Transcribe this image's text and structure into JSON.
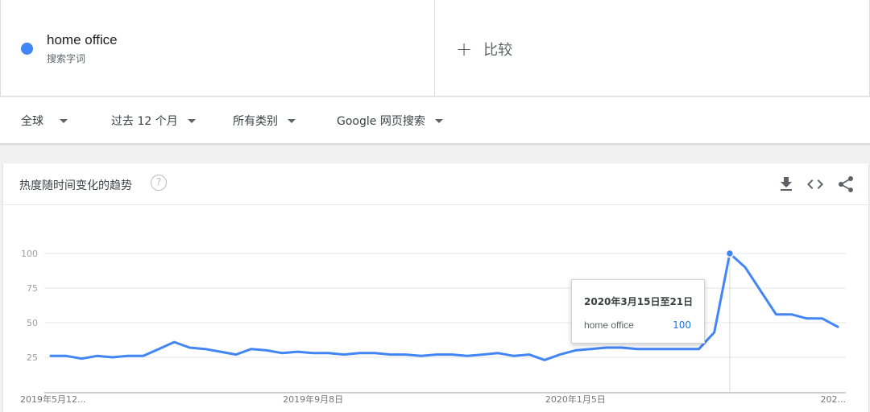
{
  "search_term": {
    "name": "home office",
    "subtitle": "搜索字词",
    "color": "#4285f4"
  },
  "compare": {
    "label": "比较"
  },
  "filters": {
    "region": "全球",
    "time": "过去 12 个月",
    "category": "所有类别",
    "type": "Google 网页搜索"
  },
  "card": {
    "title": "热度随时间变化的趋势",
    "help_glyph": "?"
  },
  "actions": [
    "download-icon",
    "embed-icon",
    "share-icon"
  ],
  "tooltip": {
    "date": "2020年3月15日至21日",
    "term": "home office",
    "value": "100"
  },
  "chart_data": {
    "type": "line",
    "ylim": [
      0,
      100
    ],
    "y_ticks": [
      25,
      50,
      75,
      100
    ],
    "x_tick_labels": [
      "2019年5月12...",
      "2019年9月8日",
      "2020年1月5日",
      "202..."
    ],
    "series": [
      {
        "name": "home office",
        "color": "#4285f4",
        "values": [
          26,
          26,
          24,
          26,
          25,
          26,
          26,
          31,
          36,
          32,
          31,
          29,
          27,
          31,
          30,
          28,
          29,
          28,
          28,
          27,
          28,
          28,
          27,
          27,
          26,
          27,
          27,
          26,
          27,
          28,
          26,
          27,
          23,
          27,
          30,
          31,
          32,
          32,
          31,
          31,
          31,
          31,
          31,
          43,
          100,
          90,
          73,
          56,
          56,
          53,
          53,
          47
        ]
      }
    ],
    "highlight_index": 44,
    "grid": true
  }
}
